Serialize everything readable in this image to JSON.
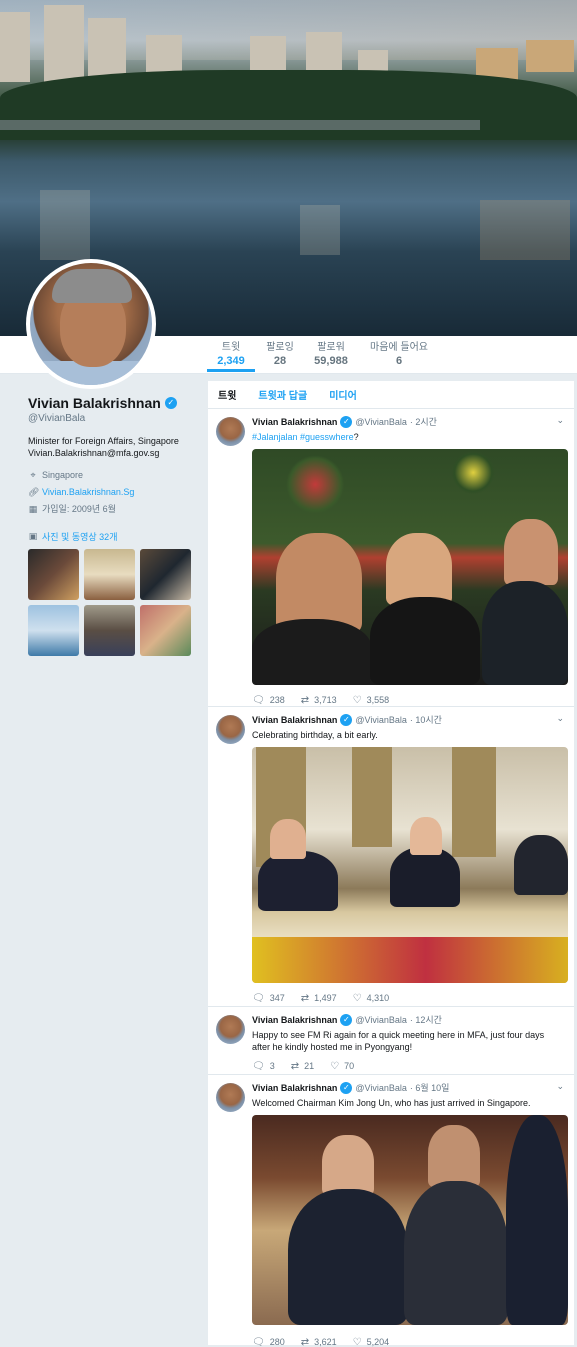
{
  "profile": {
    "name": "Vivian Balakrishnan",
    "handle": "@VivianBala",
    "bio_line1": "Minister for Foreign Affairs, Singapore",
    "bio_line2": "Vivian.Balakrishnan@mfa.gov.sg",
    "location": "Singapore",
    "website": "Vivian.Balakrishnan.Sg",
    "joined": "가입일: 2009년 6월",
    "media_link": "사진 및 동영상 32개"
  },
  "nav": {
    "tweets_label": "트윗",
    "tweets_value": "2,349",
    "following_label": "팔로잉",
    "following_value": "28",
    "followers_label": "팔로워",
    "followers_value": "59,988",
    "likes_label": "마음에 들어요",
    "likes_value": "6"
  },
  "tabs": [
    "트윗",
    "트윗과 답글",
    "미디어"
  ],
  "tweets": [
    {
      "name": "Vivian Balakrishnan",
      "handle": "@VivianBala",
      "time": "· 2시간",
      "text_tags": "#Jalanjalan #guesswhere",
      "text_suffix": "?",
      "replies": "238",
      "retweets": "3,713",
      "likes": "3,558"
    },
    {
      "name": "Vivian Balakrishnan",
      "handle": "@VivianBala",
      "time": "· 10시간",
      "text": "Celebrating birthday, a bit early.",
      "replies": "347",
      "retweets": "1,497",
      "likes": "4,310"
    },
    {
      "name": "Vivian Balakrishnan",
      "handle": "@VivianBala",
      "time": "· 12시간",
      "text": "Happy to see FM Ri again for a quick meeting here in MFA, just four days after he kindly hosted me in Pyongyang!",
      "replies": "3",
      "retweets": "21",
      "likes": "70"
    },
    {
      "name": "Vivian Balakrishnan",
      "handle": "@VivianBala",
      "time": "· 6월 10일",
      "text": "Welcomed Chairman Kim Jong Un,  who has just arrived in Singapore.",
      "replies": "280",
      "retweets": "3,621",
      "likes": "5,204"
    }
  ],
  "colors": {
    "accent": "#1da1f2",
    "background": "#e6ecf0"
  },
  "icons": {
    "verified": "verified-badge-icon",
    "location": "location-pin-icon",
    "link": "link-icon",
    "calendar": "calendar-icon",
    "media": "image-icon",
    "reply": "reply-icon",
    "retweet": "retweet-icon",
    "like": "heart-icon",
    "caret": "chevron-down-icon"
  }
}
